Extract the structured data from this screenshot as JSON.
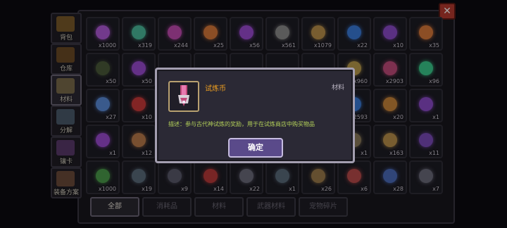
{
  "sidebar": {
    "tabs": [
      {
        "label": "背包",
        "icon": "backpack-icon",
        "color": "#7a5a2a"
      },
      {
        "label": "仓库",
        "icon": "warehouse-icon",
        "color": "#6a4a26"
      },
      {
        "label": "材料",
        "icon": "material-icon",
        "color": "#7a6a4a"
      },
      {
        "label": "分解",
        "icon": "disassemble-icon",
        "color": "#4a5a6a"
      },
      {
        "label": "镶卡",
        "icon": "card-icon",
        "color": "#5a3a6a"
      },
      {
        "label": "装备方案",
        "icon": "equipment-plan-icon",
        "color": "#6a4a3a"
      }
    ],
    "active_index": 2
  },
  "grid": {
    "rows": [
      [
        {
          "icon": "purple-gem-icon",
          "count": "x1000",
          "color": "#b05ad8"
        },
        {
          "icon": "green-gem-icon",
          "count": "x319",
          "color": "#4ab89a"
        },
        {
          "icon": "pink-crystal-icon",
          "count": "x244",
          "color": "#c04ab0"
        },
        {
          "icon": "orange-coin-icon",
          "count": "x25",
          "color": "#d8783a"
        },
        {
          "icon": "purple-flame-icon",
          "count": "x56",
          "color": "#9a4ad0"
        },
        {
          "icon": "ore-pile-icon",
          "count": "x561",
          "color": "#8a8a8a"
        },
        {
          "icon": "gold-ore-icon",
          "count": "x1079",
          "color": "#b8904a"
        },
        {
          "icon": "blue-drop-icon",
          "count": "x22",
          "color": "#3a7ad8"
        },
        {
          "icon": "purple-drop-icon",
          "count": "x10",
          "color": "#8a4ac8"
        },
        {
          "icon": "orange-drop-icon",
          "count": "x35",
          "color": "#d8783a"
        }
      ],
      [
        {
          "icon": "dark-coin-icon",
          "count": "x50",
          "color": "#4a5a3a"
        },
        {
          "icon": "purple-box-icon",
          "count": "x50",
          "color": "#9a4ad0"
        },
        {
          "icon": "",
          "count": "",
          "color": "#1d1c24"
        },
        {
          "icon": "",
          "count": "",
          "color": "#1d1c24"
        },
        {
          "icon": "",
          "count": "",
          "color": "#1d1c24"
        },
        {
          "icon": "",
          "count": "",
          "color": "#1d1c24"
        },
        {
          "icon": "",
          "count": "",
          "color": "#1d1c24"
        },
        {
          "icon": "shield-icon",
          "count": "x960",
          "color": "#b89a4a"
        },
        {
          "icon": "trial-coin-icon",
          "count": "x2903",
          "color": "#c04a7a"
        },
        {
          "icon": "green-cone-icon",
          "count": "x96",
          "color": "#3ac88a"
        }
      ],
      [
        {
          "icon": "dice-icon",
          "count": "x27",
          "color": "#5a8ad8"
        },
        {
          "icon": "heart-icon",
          "count": "x10",
          "color": "#c83a3a"
        },
        {
          "icon": "",
          "count": "",
          "color": "#1d1c24"
        },
        {
          "icon": "",
          "count": "",
          "color": "#1d1c24"
        },
        {
          "icon": "",
          "count": "",
          "color": "#1d1c24"
        },
        {
          "icon": "",
          "count": "",
          "color": "#1d1c24"
        },
        {
          "icon": "",
          "count": "",
          "color": "#1d1c24"
        },
        {
          "icon": "blue-gem-icon",
          "count": "x2593",
          "color": "#3a7ad8"
        },
        {
          "icon": "wood-icon",
          "count": "x20",
          "color": "#c8843a"
        },
        {
          "icon": "purple-book-icon",
          "count": "x1",
          "color": "#8a4ac8"
        }
      ],
      [
        {
          "icon": "scroll-icon",
          "count": "x1",
          "color": "#9a4ad0"
        },
        {
          "icon": "chest-icon",
          "count": "x12",
          "color": "#b87a4a"
        },
        {
          "icon": "",
          "count": "",
          "color": "#1d1c24"
        },
        {
          "icon": "",
          "count": "",
          "color": "#1d1c24"
        },
        {
          "icon": "",
          "count": "",
          "color": "#1d1c24"
        },
        {
          "icon": "",
          "count": "",
          "color": "#1d1c24"
        },
        {
          "icon": "",
          "count": "",
          "color": "#1d1c24"
        },
        {
          "icon": "wand-icon",
          "count": "x1",
          "color": "#8a7a5a"
        },
        {
          "icon": "crystal-cluster-icon",
          "count": "x163",
          "color": "#b8904a"
        },
        {
          "icon": "purple-tome-icon",
          "count": "x11",
          "color": "#7a4ab8"
        }
      ],
      [
        {
          "icon": "green-orb-icon",
          "count": "x1000",
          "color": "#4a9a4a"
        },
        {
          "icon": "blade-icon",
          "count": "x19",
          "color": "#5a6a7a"
        },
        {
          "icon": "barrel-icon",
          "count": "x9",
          "color": "#5a5a6a"
        },
        {
          "icon": "red-stick-icon",
          "count": "x14",
          "color": "#b83a3a"
        },
        {
          "icon": "bolt-icon",
          "count": "x22",
          "color": "#6a6a7a"
        },
        {
          "icon": "pipe-icon",
          "count": "x1",
          "color": "#5a6a7a"
        },
        {
          "icon": "bronze-pipe-icon",
          "count": "x26",
          "color": "#9a7a4a"
        },
        {
          "icon": "red-feather-icon",
          "count": "x6",
          "color": "#b84a4a"
        },
        {
          "icon": "blue-hook-icon",
          "count": "x28",
          "color": "#4a6ab8"
        },
        {
          "icon": "crescent-icon",
          "count": "x7",
          "color": "#6a6a7a"
        }
      ]
    ]
  },
  "bottom_tabs": [
    {
      "label": "全部"
    },
    {
      "label": "消耗品"
    },
    {
      "label": "材料"
    },
    {
      "label": "武器材料"
    },
    {
      "label": "宠物碎片"
    }
  ],
  "bottom_active_index": 0,
  "close_label": "✕",
  "dialog": {
    "title": "试炼币",
    "category": "材料",
    "description": "描述：参与古代神试炼的奖励，用于在试炼商店中购买物品",
    "confirm_label": "确定",
    "icon": "trial-coin-icon"
  }
}
